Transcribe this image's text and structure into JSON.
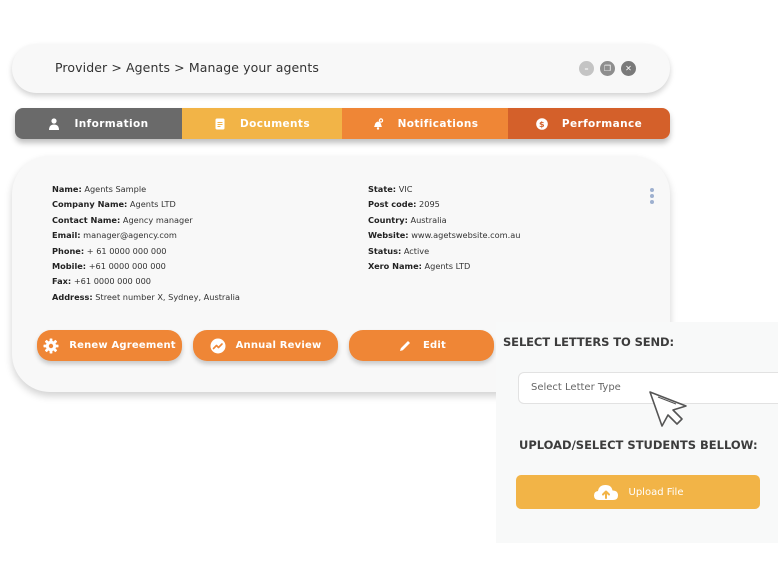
{
  "header": {
    "breadcrumb": "Provider > Agents > Manage your agents",
    "window_controls": [
      {
        "name": "minimize",
        "glyph": "–"
      },
      {
        "name": "restore",
        "glyph": "❐"
      },
      {
        "name": "close",
        "glyph": "✕"
      }
    ]
  },
  "tabs": [
    {
      "label": "Information",
      "icon": "user-icon",
      "color": "#6a6a6a"
    },
    {
      "label": "Documents",
      "icon": "document-icon",
      "color": "#f2b447"
    },
    {
      "label": "Notifications",
      "icon": "bell-icon",
      "color": "#ef8636"
    },
    {
      "label": "Performance",
      "icon": "dollar-icon",
      "color": "#d4602a"
    }
  ],
  "agent": {
    "left": [
      {
        "label": "Name:",
        "value": "Agents Sample"
      },
      {
        "label": "Company Name:",
        "value": "Agents LTD"
      },
      {
        "label": "Contact Name:",
        "value": "Agency manager"
      },
      {
        "label": "Email:",
        "value": "manager@agency.com"
      },
      {
        "label": "Phone:",
        "value": "+ 61 0000 000 000"
      },
      {
        "label": "Mobile:",
        "value": "+61 0000 000 000"
      },
      {
        "label": "Fax:",
        "value": "+61 0000 000 000"
      },
      {
        "label": "Address:",
        "value": "Street number X, Sydney, Australia"
      }
    ],
    "right": [
      {
        "label": "State:",
        "value": "VIC"
      },
      {
        "label": "Post code:",
        "value": "2095"
      },
      {
        "label": "Country:",
        "value": "Australia"
      },
      {
        "label": "Website:",
        "value": "www.agetswebsite.com.au"
      },
      {
        "label": "Status:",
        "value": "Active"
      },
      {
        "label": "Xero Name:",
        "value": "Agents LTD"
      }
    ]
  },
  "actions": [
    {
      "label": "Renew Agreement",
      "icon": "gear-icon"
    },
    {
      "label": "Annual Review",
      "icon": "trend-icon"
    },
    {
      "label": "Edit",
      "icon": "pencil-icon"
    }
  ],
  "letters_panel": {
    "title": "SELECT LETTERS TO SEND:",
    "select_placeholder": "Select Letter Type",
    "upload_title": "UPLOAD/SELECT STUDENTS BELLOW:",
    "upload_label": "Upload File"
  },
  "colors": {
    "accent_orange": "#ef8636",
    "accent_yellow": "#f2b447",
    "accent_dark_orange": "#d4602a",
    "tab_gray": "#6a6a6a"
  }
}
